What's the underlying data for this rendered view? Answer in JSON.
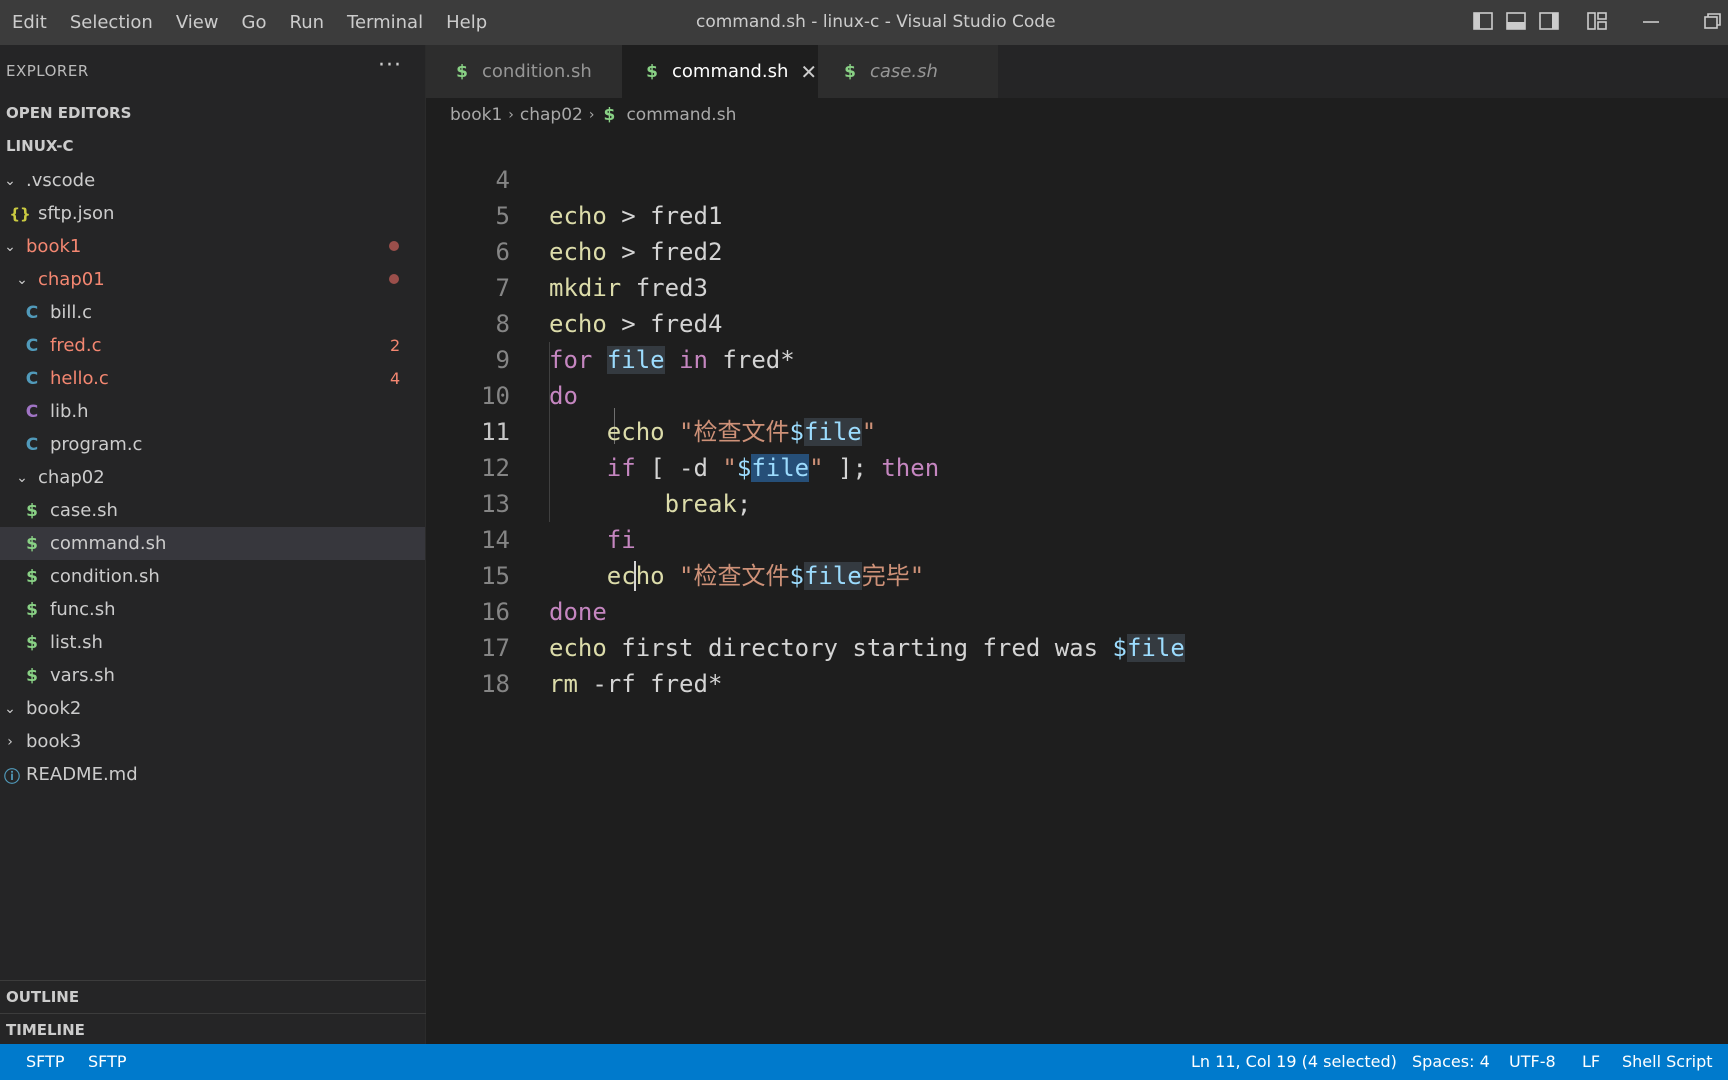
{
  "window": {
    "title": "command.sh - linux-c - Visual Studio Code",
    "menu": [
      "Edit",
      "Selection",
      "View",
      "Go",
      "Run",
      "Terminal",
      "Help"
    ]
  },
  "explorer": {
    "header": "EXPLORER",
    "more": "···",
    "open_editors": "OPEN EDITORS",
    "workspace": "LINUX-C",
    "items": [
      {
        "label": ".vscode",
        "type": "folder",
        "expanded": true
      },
      {
        "label": "sftp.json",
        "type": "file",
        "icon": "{}"
      },
      {
        "label": "book1",
        "type": "folder",
        "expanded": true,
        "modified": true
      },
      {
        "label": "chap01",
        "type": "folder",
        "expanded": true,
        "modified": true
      },
      {
        "label": "bill.c",
        "type": "file",
        "icon": "C"
      },
      {
        "label": "fred.c",
        "type": "file",
        "icon": "C",
        "errors": "2"
      },
      {
        "label": "hello.c",
        "type": "file",
        "icon": "C",
        "errors": "4"
      },
      {
        "label": "lib.h",
        "type": "file",
        "icon": "C"
      },
      {
        "label": "program.c",
        "type": "file",
        "icon": "C"
      },
      {
        "label": "chap02",
        "type": "folder",
        "expanded": true
      },
      {
        "label": "case.sh",
        "type": "file",
        "icon": "$"
      },
      {
        "label": "command.sh",
        "type": "file",
        "icon": "$",
        "selected": true
      },
      {
        "label": "condition.sh",
        "type": "file",
        "icon": "$"
      },
      {
        "label": "func.sh",
        "type": "file",
        "icon": "$"
      },
      {
        "label": "list.sh",
        "type": "file",
        "icon": "$"
      },
      {
        "label": "vars.sh",
        "type": "file",
        "icon": "$"
      },
      {
        "label": "book2",
        "type": "folder",
        "expanded": true
      },
      {
        "label": "book3",
        "type": "folder",
        "expanded": false
      },
      {
        "label": "README.md",
        "type": "file",
        "icon": "ⓘ"
      }
    ],
    "outline": "OUTLINE",
    "timeline": "TIMELINE"
  },
  "tabs": [
    {
      "label": "condition.sh",
      "icon": "$",
      "active": false
    },
    {
      "label": "command.sh",
      "icon": "$",
      "active": true,
      "close": "✕"
    },
    {
      "label": "case.sh",
      "icon": "$",
      "active": false,
      "preview": true
    }
  ],
  "breadcrumb": {
    "parts": [
      "book1",
      "chap02"
    ],
    "icon": "$",
    "file": "command.sh"
  },
  "editor": {
    "line_numbers": [
      "4",
      "5",
      "6",
      "7",
      "8",
      "9",
      "10",
      "11",
      "12",
      "13",
      "14",
      "15",
      "16",
      "17",
      "18"
    ],
    "active_line": "11"
  },
  "statusbar": {
    "sftp1": "SFTP",
    "sftp2": "SFTP",
    "position": "Ln 11, Col 19 (4 selected)",
    "spaces": "Spaces: 4",
    "encoding": "UTF-8",
    "eol": "LF",
    "language": "Shell Script"
  },
  "colors": {
    "statusbar": "#007acc",
    "keyword": "#c586c0",
    "string": "#ce9178",
    "variable": "#9cdcfe",
    "error": "#f48771"
  }
}
